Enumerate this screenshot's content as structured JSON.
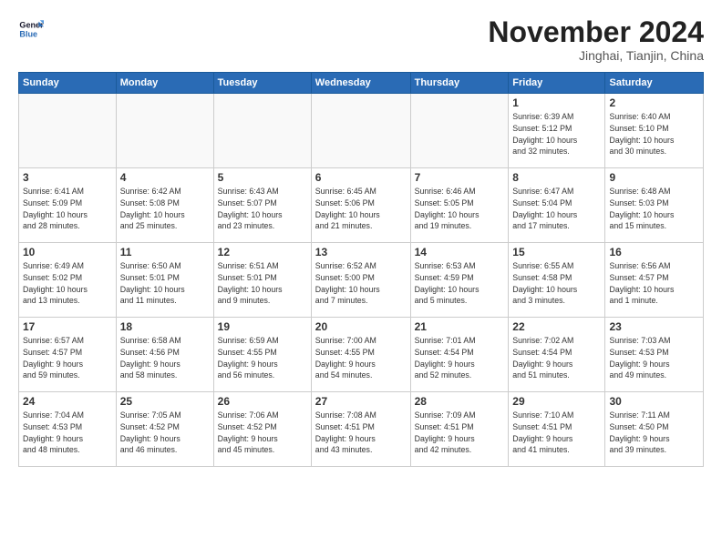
{
  "logo": {
    "line1": "General",
    "line2": "Blue"
  },
  "title": "November 2024",
  "subtitle": "Jinghai, Tianjin, China",
  "weekdays": [
    "Sunday",
    "Monday",
    "Tuesday",
    "Wednesday",
    "Thursday",
    "Friday",
    "Saturday"
  ],
  "weeks": [
    [
      {
        "day": "",
        "info": ""
      },
      {
        "day": "",
        "info": ""
      },
      {
        "day": "",
        "info": ""
      },
      {
        "day": "",
        "info": ""
      },
      {
        "day": "",
        "info": ""
      },
      {
        "day": "1",
        "info": "Sunrise: 6:39 AM\nSunset: 5:12 PM\nDaylight: 10 hours\nand 32 minutes."
      },
      {
        "day": "2",
        "info": "Sunrise: 6:40 AM\nSunset: 5:10 PM\nDaylight: 10 hours\nand 30 minutes."
      }
    ],
    [
      {
        "day": "3",
        "info": "Sunrise: 6:41 AM\nSunset: 5:09 PM\nDaylight: 10 hours\nand 28 minutes."
      },
      {
        "day": "4",
        "info": "Sunrise: 6:42 AM\nSunset: 5:08 PM\nDaylight: 10 hours\nand 25 minutes."
      },
      {
        "day": "5",
        "info": "Sunrise: 6:43 AM\nSunset: 5:07 PM\nDaylight: 10 hours\nand 23 minutes."
      },
      {
        "day": "6",
        "info": "Sunrise: 6:45 AM\nSunset: 5:06 PM\nDaylight: 10 hours\nand 21 minutes."
      },
      {
        "day": "7",
        "info": "Sunrise: 6:46 AM\nSunset: 5:05 PM\nDaylight: 10 hours\nand 19 minutes."
      },
      {
        "day": "8",
        "info": "Sunrise: 6:47 AM\nSunset: 5:04 PM\nDaylight: 10 hours\nand 17 minutes."
      },
      {
        "day": "9",
        "info": "Sunrise: 6:48 AM\nSunset: 5:03 PM\nDaylight: 10 hours\nand 15 minutes."
      }
    ],
    [
      {
        "day": "10",
        "info": "Sunrise: 6:49 AM\nSunset: 5:02 PM\nDaylight: 10 hours\nand 13 minutes."
      },
      {
        "day": "11",
        "info": "Sunrise: 6:50 AM\nSunset: 5:01 PM\nDaylight: 10 hours\nand 11 minutes."
      },
      {
        "day": "12",
        "info": "Sunrise: 6:51 AM\nSunset: 5:01 PM\nDaylight: 10 hours\nand 9 minutes."
      },
      {
        "day": "13",
        "info": "Sunrise: 6:52 AM\nSunset: 5:00 PM\nDaylight: 10 hours\nand 7 minutes."
      },
      {
        "day": "14",
        "info": "Sunrise: 6:53 AM\nSunset: 4:59 PM\nDaylight: 10 hours\nand 5 minutes."
      },
      {
        "day": "15",
        "info": "Sunrise: 6:55 AM\nSunset: 4:58 PM\nDaylight: 10 hours\nand 3 minutes."
      },
      {
        "day": "16",
        "info": "Sunrise: 6:56 AM\nSunset: 4:57 PM\nDaylight: 10 hours\nand 1 minute."
      }
    ],
    [
      {
        "day": "17",
        "info": "Sunrise: 6:57 AM\nSunset: 4:57 PM\nDaylight: 9 hours\nand 59 minutes."
      },
      {
        "day": "18",
        "info": "Sunrise: 6:58 AM\nSunset: 4:56 PM\nDaylight: 9 hours\nand 58 minutes."
      },
      {
        "day": "19",
        "info": "Sunrise: 6:59 AM\nSunset: 4:55 PM\nDaylight: 9 hours\nand 56 minutes."
      },
      {
        "day": "20",
        "info": "Sunrise: 7:00 AM\nSunset: 4:55 PM\nDaylight: 9 hours\nand 54 minutes."
      },
      {
        "day": "21",
        "info": "Sunrise: 7:01 AM\nSunset: 4:54 PM\nDaylight: 9 hours\nand 52 minutes."
      },
      {
        "day": "22",
        "info": "Sunrise: 7:02 AM\nSunset: 4:54 PM\nDaylight: 9 hours\nand 51 minutes."
      },
      {
        "day": "23",
        "info": "Sunrise: 7:03 AM\nSunset: 4:53 PM\nDaylight: 9 hours\nand 49 minutes."
      }
    ],
    [
      {
        "day": "24",
        "info": "Sunrise: 7:04 AM\nSunset: 4:53 PM\nDaylight: 9 hours\nand 48 minutes."
      },
      {
        "day": "25",
        "info": "Sunrise: 7:05 AM\nSunset: 4:52 PM\nDaylight: 9 hours\nand 46 minutes."
      },
      {
        "day": "26",
        "info": "Sunrise: 7:06 AM\nSunset: 4:52 PM\nDaylight: 9 hours\nand 45 minutes."
      },
      {
        "day": "27",
        "info": "Sunrise: 7:08 AM\nSunset: 4:51 PM\nDaylight: 9 hours\nand 43 minutes."
      },
      {
        "day": "28",
        "info": "Sunrise: 7:09 AM\nSunset: 4:51 PM\nDaylight: 9 hours\nand 42 minutes."
      },
      {
        "day": "29",
        "info": "Sunrise: 7:10 AM\nSunset: 4:51 PM\nDaylight: 9 hours\nand 41 minutes."
      },
      {
        "day": "30",
        "info": "Sunrise: 7:11 AM\nSunset: 4:50 PM\nDaylight: 9 hours\nand 39 minutes."
      }
    ]
  ]
}
